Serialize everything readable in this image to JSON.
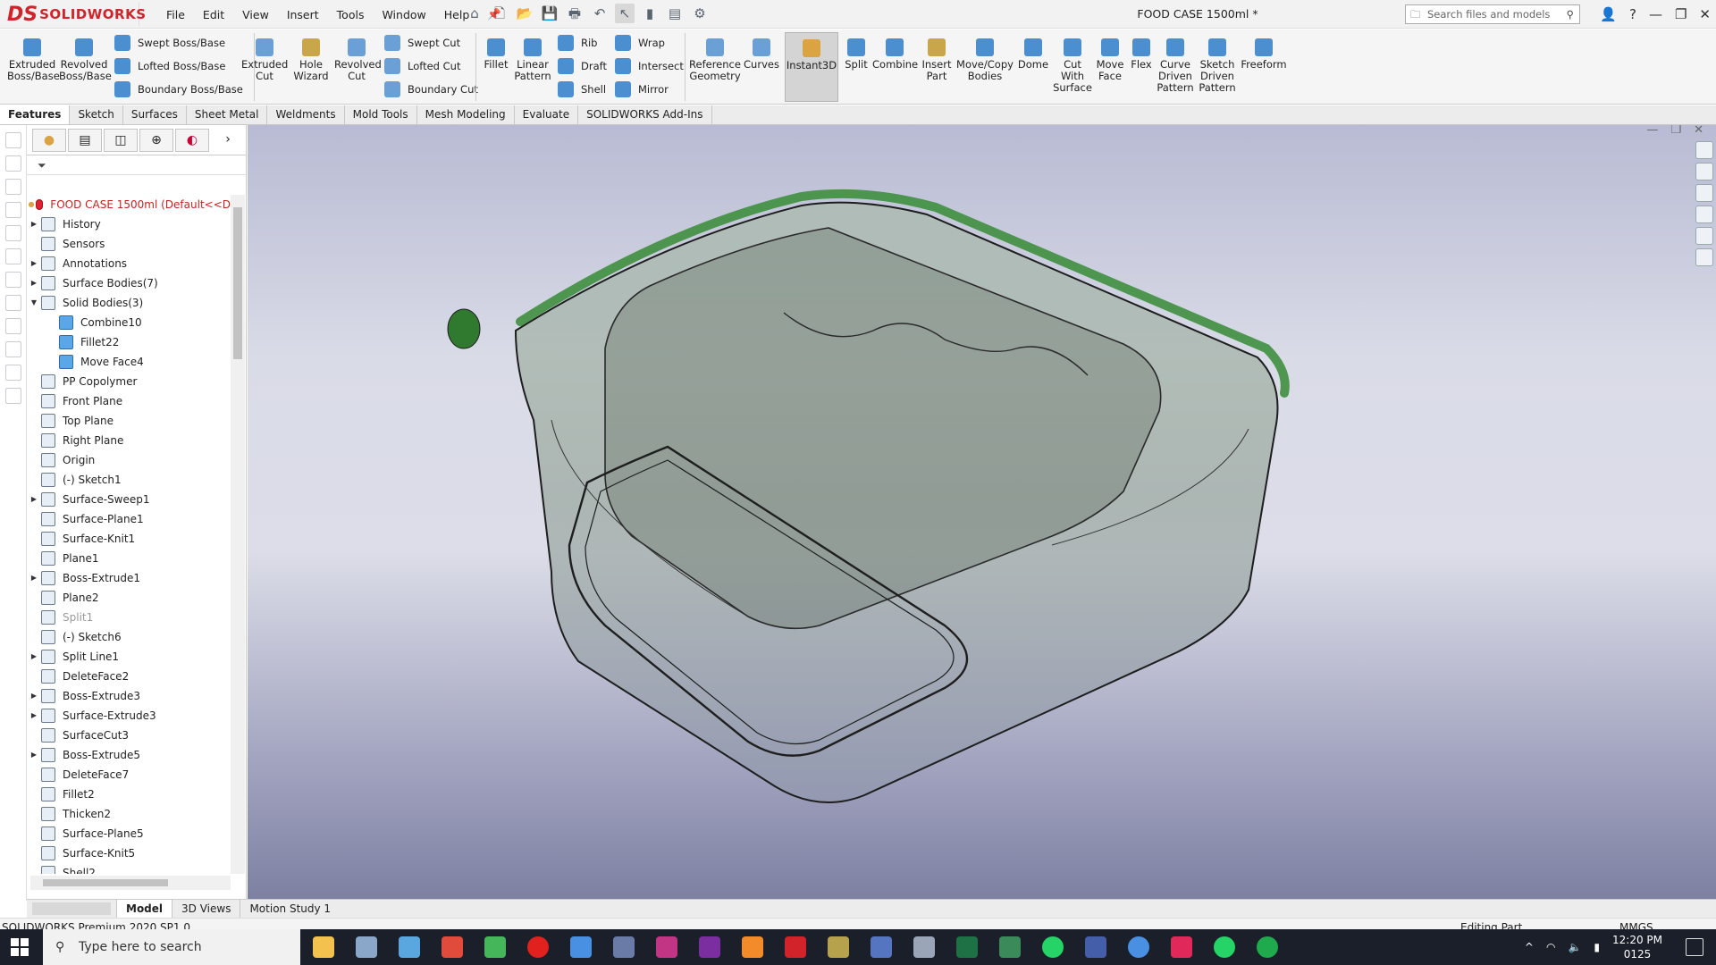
{
  "app": {
    "name": "SOLIDWORKS",
    "logo_mark": "DS",
    "document_title": "FOOD CASE 1500ml *"
  },
  "menu": [
    "File",
    "Edit",
    "View",
    "Insert",
    "Tools",
    "Window",
    "Help"
  ],
  "search": {
    "placeholder": "Search files and models"
  },
  "commands": {
    "extruded_boss": "Extruded Boss/Base",
    "revolved_boss": "Revolved Boss/Base",
    "swept_boss": "Swept Boss/Base",
    "lofted_boss": "Lofted Boss/Base",
    "boundary_boss": "Boundary Boss/Base",
    "extruded_cut": "Extruded Cut",
    "hole_wizard": "Hole Wizard",
    "revolved_cut": "Revolved Cut",
    "swept_cut": "Swept Cut",
    "lofted_cut": "Lofted Cut",
    "boundary_cut": "Boundary Cut",
    "fillet": "Fillet",
    "linear_pattern": "Linear Pattern",
    "rib": "Rib",
    "draft": "Draft",
    "shell": "Shell",
    "wrap": "Wrap",
    "intersect": "Intersect",
    "mirror": "Mirror",
    "reference_geometry": "Reference Geometry",
    "curves": "Curves",
    "instant3d": "Instant3D",
    "split": "Split",
    "combine": "Combine",
    "insert_part": "Insert Part",
    "move_copy_bodies": "Move/Copy Bodies",
    "dome": "Dome",
    "cut_with_surface": "Cut With Surface",
    "move_face": "Move Face",
    "flex": "Flex",
    "curve_driven_pattern": "Curve Driven Pattern",
    "sketch_driven_pattern": "Sketch Driven Pattern",
    "freeform": "Freeform"
  },
  "tabs": [
    "Features",
    "Sketch",
    "Surfaces",
    "Sheet Metal",
    "Weldments",
    "Mold Tools",
    "Mesh Modeling",
    "Evaluate",
    "SOLIDWORKS Add-Ins"
  ],
  "tree": {
    "root": "FOOD CASE 1500ml  (Default<<D",
    "items": [
      {
        "label": "History",
        "expand": true
      },
      {
        "label": "Sensors",
        "expand": false
      },
      {
        "label": "Annotations",
        "expand": true
      },
      {
        "label": "Surface Bodies(7)",
        "expand": true
      },
      {
        "label": "Solid Bodies(3)",
        "expand": true,
        "open": true
      },
      {
        "label": "Combine10",
        "child": true
      },
      {
        "label": "Fillet22",
        "child": true
      },
      {
        "label": "Move Face4",
        "child": true
      },
      {
        "label": "PP Copolymer"
      },
      {
        "label": "Front Plane"
      },
      {
        "label": "Top Plane"
      },
      {
        "label": "Right Plane"
      },
      {
        "label": "Origin"
      },
      {
        "label": "(-) Sketch1"
      },
      {
        "label": "Surface-Sweep1",
        "expand": true
      },
      {
        "label": "Surface-Plane1"
      },
      {
        "label": "Surface-Knit1"
      },
      {
        "label": "Plane1"
      },
      {
        "label": "Boss-Extrude1",
        "expand": true
      },
      {
        "label": "Plane2"
      },
      {
        "label": "Split1",
        "disabled": true
      },
      {
        "label": "(-) Sketch6"
      },
      {
        "label": "Split Line1",
        "expand": true
      },
      {
        "label": "DeleteFace2"
      },
      {
        "label": "Boss-Extrude3",
        "expand": true
      },
      {
        "label": "Surface-Extrude3",
        "expand": true
      },
      {
        "label": "SurfaceCut3"
      },
      {
        "label": "Boss-Extrude5",
        "expand": true
      },
      {
        "label": "DeleteFace7"
      },
      {
        "label": "Fillet2"
      },
      {
        "label": "Thicken2"
      },
      {
        "label": "Surface-Plane5"
      },
      {
        "label": "Surface-Knit5"
      },
      {
        "label": "Shell2"
      }
    ]
  },
  "bottom_tabs": [
    "Model",
    "3D Views",
    "Motion Study 1"
  ],
  "status": {
    "left": "SOLIDWORKS Premium 2020 SP1.0",
    "mode": "Editing Part",
    "units": "MMGS"
  },
  "taskbar": {
    "search_placeholder": "Type here to search",
    "time": "12:20 PM",
    "date": "0125"
  },
  "colors": {
    "brand": "#d2232a",
    "accent_green": "#3f8f3f",
    "viewport_top": "#b8bbd3",
    "viewport_bottom": "#7e80a2"
  }
}
